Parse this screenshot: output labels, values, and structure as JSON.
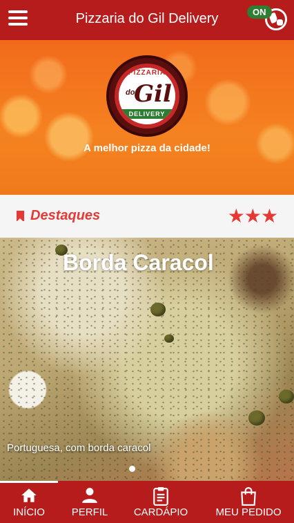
{
  "header": {
    "title": "Pizzaria do Gil Delivery",
    "status_badge": "ON",
    "menu_icon": "hamburger-menu-icon",
    "status_icon": "store-status-icon"
  },
  "hero": {
    "logo": {
      "top_text": "PIZZARIA",
      "do_text": "do",
      "name_text": "Gil",
      "bottom_text": "DELIVERY"
    },
    "tagline": "A melhor pizza da cidade!"
  },
  "featured": {
    "title": "Destaques",
    "stars": "★★★",
    "rating": 3,
    "icon": "bookmark-icon"
  },
  "carousel": {
    "slide_title": "Borda Caracol",
    "slide_caption": "Portuguesa, com borda caracol",
    "active_index": 0
  },
  "bottom_nav": {
    "items": [
      {
        "label": "INÍCIO",
        "icon": "home-icon",
        "active": true
      },
      {
        "label": "PERFIL",
        "icon": "profile-icon",
        "active": false
      },
      {
        "label": "CARDÁPIO",
        "icon": "menu-clipboard-icon",
        "active": false
      },
      {
        "label": "MEU PEDIDO",
        "icon": "shopping-bag-icon",
        "active": false
      }
    ]
  },
  "colors": {
    "primary": "#b71c1c",
    "accent": "#e53935",
    "hero": "#f58220",
    "online": "#2e7d32"
  }
}
